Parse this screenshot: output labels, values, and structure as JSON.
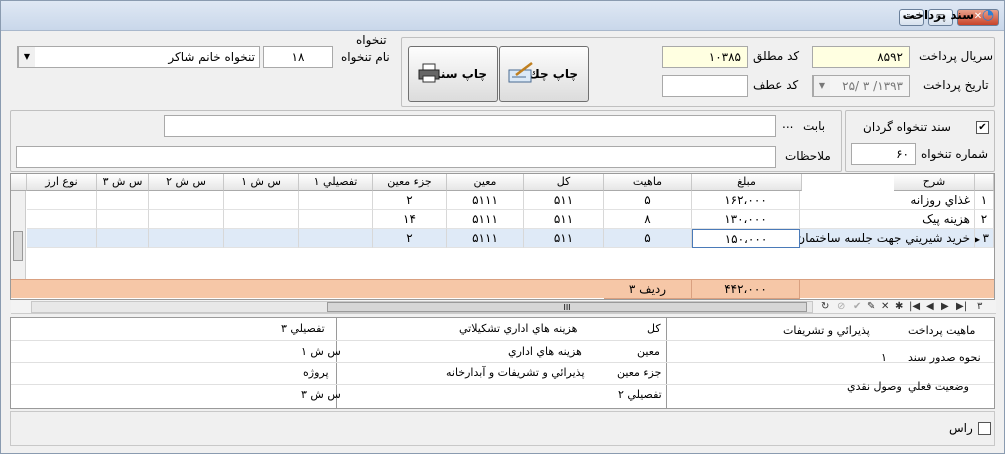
{
  "window": {
    "title": "سند پرداخت",
    "controls": [
      "minimize",
      "maximize",
      "close"
    ]
  },
  "header": {
    "serial_label": "سريال پرداخت",
    "serial_value": "۸۵۹۲",
    "abs_code_label": "کد مطلق",
    "abs_code_value": "۱۰۳۸۵",
    "date_label": "تاريخ پرداخت",
    "date_value": "۱۳۹۳/ ۳ /۲۵",
    "atf_label": "کد عطف",
    "atf_value": "",
    "print_check_label": "چاپ چك",
    "print_doc_label": "چاپ سند",
    "salary_group_label": "تنخواه",
    "salary_name_label": "نام تنخواه",
    "salary_code": "۱۸",
    "salary_name": "تنخواه خانم شاكر"
  },
  "options": {
    "revolving_label": "سند تنخواه گردان",
    "revolving_checked": true,
    "salary_no_label": "شماره تنخواه",
    "salary_no_value": "۶۰",
    "babat_label": "بابت",
    "babat_value": "",
    "mulahezat_label": "ملاحظات",
    "mulahezat_value": "",
    "ellipsis": "..."
  },
  "grid": {
    "columns": [
      "شرح",
      "مبلغ",
      "ماهيت",
      "كل",
      "معين",
      "جزء معين",
      "تفصيلي ١",
      "س ش ١",
      "س ش ٢",
      "س ش ٣",
      "نوع ارز"
    ],
    "rows": [
      {
        "num": "۱",
        "desc": "غذاي روزانه",
        "amount": "۱۶۲،۰۰۰",
        "nature": "۵",
        "kol": "۵۱۱",
        "moein": "۵۱۱۱",
        "joz": "۲",
        "tafsili": "",
        "s1": "",
        "s2": "",
        "s3": "",
        "currency": ""
      },
      {
        "num": "۲",
        "desc": "هزينه پيک",
        "amount": "۱۳۰،۰۰۰",
        "nature": "۸",
        "kol": "۵۱۱",
        "moein": "۵۱۱۱",
        "joz": "۱۴",
        "tafsili": "",
        "s1": "",
        "s2": "",
        "s3": "",
        "currency": ""
      },
      {
        "num": "۳",
        "desc": "خريد شيريني جهت جلسه ساختمان",
        "amount": "۱۵۰،۰۰۰",
        "nature": "۵",
        "kol": "۵۱۱",
        "moein": "۵۱۱۱",
        "joz": "۲",
        "tafsili": "",
        "s1": "",
        "s2": "",
        "s3": "",
        "currency": ""
      }
    ],
    "total_amount": "۴۴۲،۰۰۰",
    "total_rows_label": "رديف ۳",
    "row_count": "۳",
    "scroll_label": "III"
  },
  "details": {
    "nature_label": "ماهيت پرداخت",
    "nature_value": "پذيرائي و تشريفات",
    "issue_label": "نحوه صدور سند",
    "issue_value": "۱",
    "status_label": "وضعيت فعلي",
    "status_value": "وصول نقدي",
    "kol_label": "كل",
    "kol_value": "هزينه هاي اداري تشكيلاتي",
    "moein_label": "معين",
    "moein_value": "هزينه هاي اداري",
    "joz_label": "جزء معين",
    "joz_value": "پذيرائي و تشريفات و آبدارخانه",
    "tafsili2_label": "تفصيلي ۲",
    "tafsili3_label": "تفصيلي ۳",
    "s1_label": "س ش ۱",
    "project_label": "پروژه",
    "s3_label": "س ش ۳"
  },
  "footer": {
    "ras_label": "راس",
    "ras_checked": false
  }
}
